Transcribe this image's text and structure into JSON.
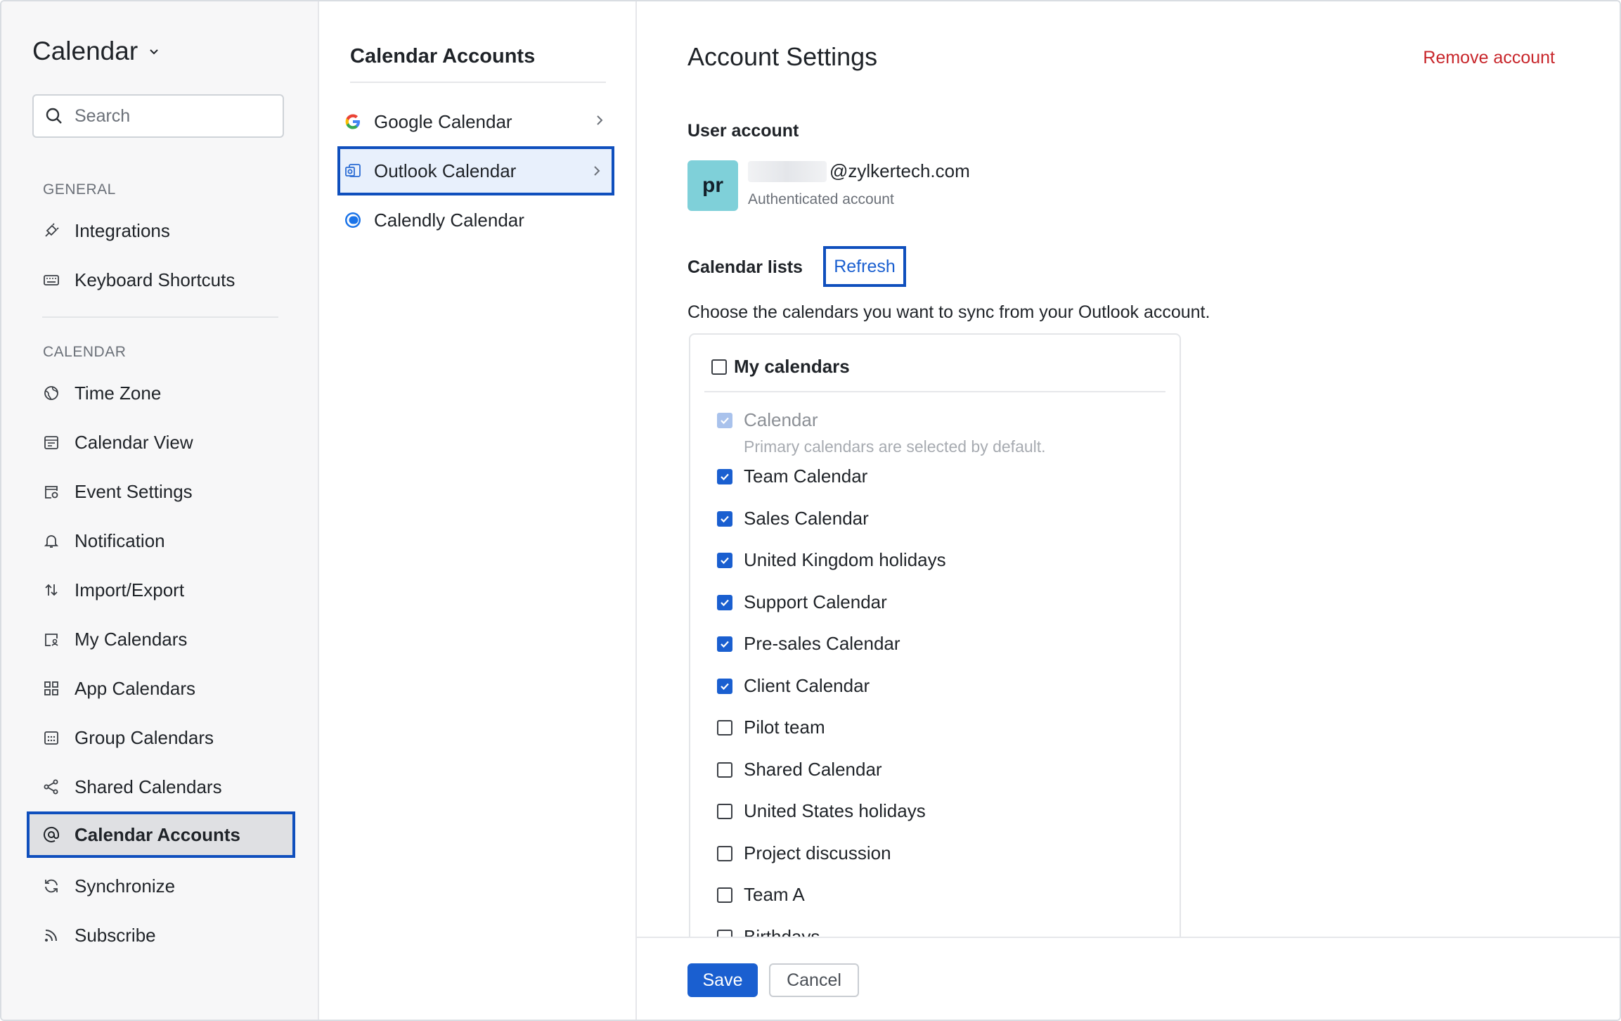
{
  "app": {
    "title": "Calendar"
  },
  "search": {
    "placeholder": "Search"
  },
  "sidebar": {
    "general_label": "GENERAL",
    "general_items": [
      {
        "label": "Integrations",
        "icon": "plug-icon"
      },
      {
        "label": "Keyboard Shortcuts",
        "icon": "keyboard-icon"
      }
    ],
    "calendar_label": "CALENDAR",
    "calendar_items": [
      {
        "label": "Time Zone",
        "icon": "globe-icon"
      },
      {
        "label": "Calendar View",
        "icon": "calendar-view-icon"
      },
      {
        "label": "Event Settings",
        "icon": "event-settings-icon"
      },
      {
        "label": "Notification",
        "icon": "bell-icon"
      },
      {
        "label": "Import/Export",
        "icon": "import-export-icon"
      },
      {
        "label": "My Calendars",
        "icon": "my-calendars-icon"
      },
      {
        "label": "App Calendars",
        "icon": "app-grid-icon"
      },
      {
        "label": "Group Calendars",
        "icon": "group-calendar-icon"
      },
      {
        "label": "Shared Calendars",
        "icon": "share-icon"
      },
      {
        "label": "Calendar Accounts",
        "icon": "at-sign-icon",
        "active": true
      },
      {
        "label": "Synchronize",
        "icon": "sync-icon"
      },
      {
        "label": "Subscribe",
        "icon": "rss-icon"
      }
    ]
  },
  "accounts": {
    "title": "Calendar Accounts",
    "items": [
      {
        "label": "Google Calendar",
        "icon": "google-icon"
      },
      {
        "label": "Outlook Calendar",
        "icon": "outlook-icon",
        "active": true
      },
      {
        "label": "Calendly Calendar",
        "icon": "calendly-icon"
      }
    ]
  },
  "settings": {
    "title": "Account Settings",
    "remove_label": "Remove account",
    "user_account_label": "User account",
    "avatar_initials": "pr",
    "email_domain": "@zylkertech.com",
    "auth_status": "Authenticated account",
    "calendar_lists_label": "Calendar lists",
    "refresh_label": "Refresh",
    "description": "Choose the calendars you want to sync from your Outlook account.",
    "group_label": "My calendars",
    "primary_calendar": "Calendar",
    "primary_hint": "Primary calendars are selected by default.",
    "calendars": [
      {
        "label": "Team Calendar",
        "checked": true
      },
      {
        "label": "Sales Calendar",
        "checked": true
      },
      {
        "label": "United Kingdom holidays",
        "checked": true
      },
      {
        "label": "Support Calendar",
        "checked": true
      },
      {
        "label": "Pre-sales Calendar",
        "checked": true
      },
      {
        "label": "Client Calendar",
        "checked": true
      },
      {
        "label": "Pilot team",
        "checked": false
      },
      {
        "label": "Shared Calendar",
        "checked": false
      },
      {
        "label": "United States holidays",
        "checked": false
      },
      {
        "label": "Project discussion",
        "checked": false
      },
      {
        "label": "Team A",
        "checked": false
      },
      {
        "label": "Birthdays",
        "checked": false
      }
    ],
    "save_label": "Save",
    "cancel_label": "Cancel"
  },
  "colors": {
    "accent": "#1a5fd0",
    "highlight_border": "#0f4fbd",
    "danger": "#c8262b"
  }
}
